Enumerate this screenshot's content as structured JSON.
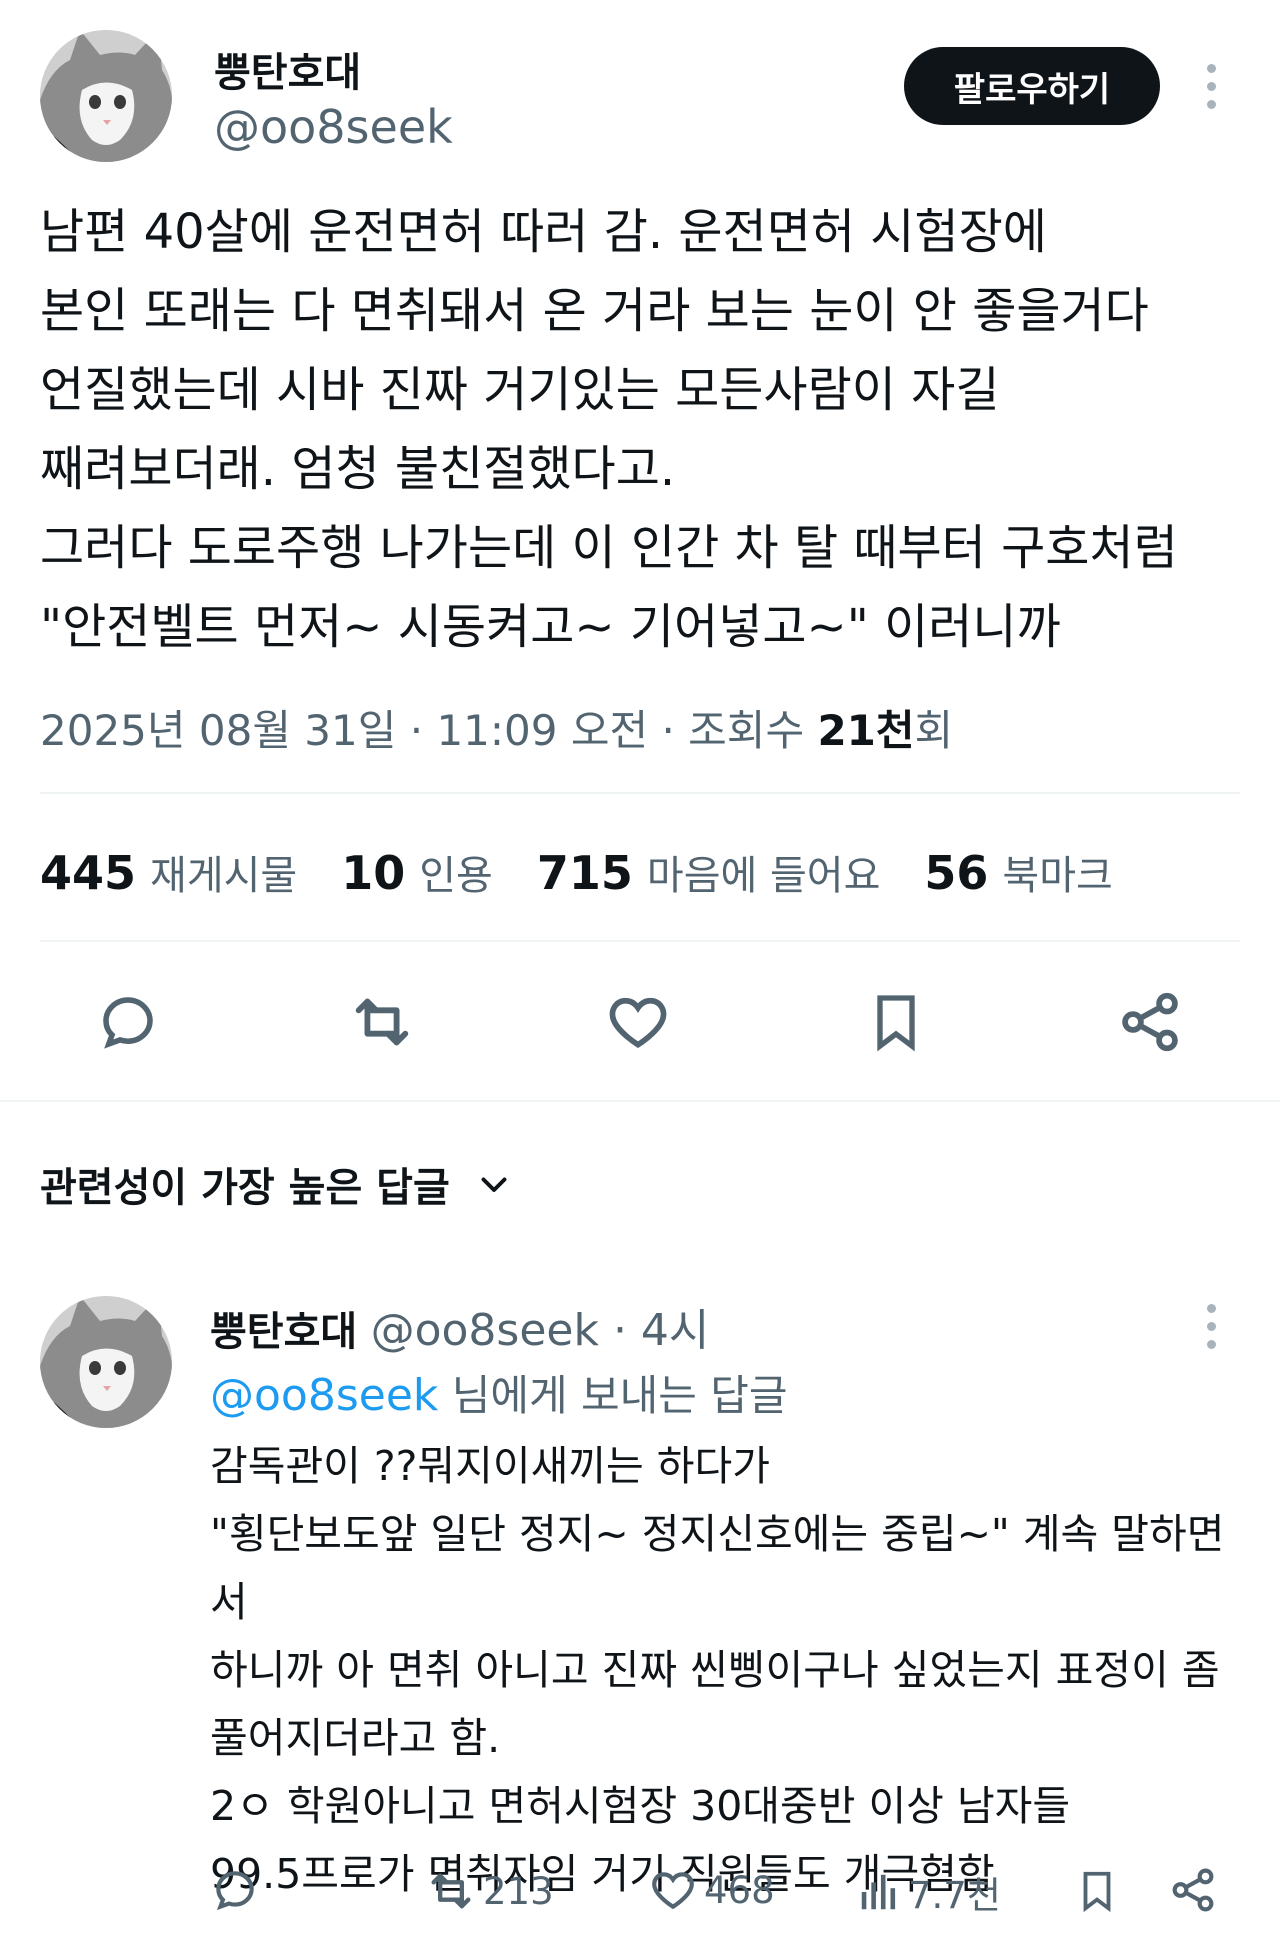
{
  "tweet": {
    "author_name": "뿡탄호대",
    "author_handle": "@oo8seek",
    "follow_label": "팔로우하기",
    "text": "남편 40살에 운전면허 따러 감. 운전면허 시험장에\n본인 또래는 다 면취돼서 온 거라 보는 눈이 안 좋을거다\n언질했는데 시바 진짜 거기있는 모든사람이 자길\n째려보더래. 엄청 불친절했다고.\n그러다 도로주행 나가는데 이 인간 차 탈 때부터 구호처럼\n\"안전벨트 먼저~ 시동켜고~  기어넣고~\" 이러니까",
    "date": "2025년 08월 31일 · 11:09 오전 · 조회수 ",
    "views": "21천",
    "views_suffix": "회"
  },
  "stats": {
    "retweets_count": "445",
    "retweets_label": "재게시물",
    "quotes_count": "10",
    "quotes_label": "인용",
    "likes_count": "715",
    "likes_label": "마음에 들어요",
    "bookmarks_count": "56",
    "bookmarks_label": "북마크"
  },
  "replies_section": {
    "sort_label": "관련성이 가장 높은 답글"
  },
  "reply": {
    "author_name": "뿡탄호대",
    "author_handle": "@oo8seek",
    "time": " · 4시",
    "replying_to_handle": "@oo8seek",
    "replying_to_suffix": " 님에게 보내는 답글",
    "text": "감독관이 ??뭐지이새끼는 하다가\n\"횡단보도앞 일단 정지~ 정지신호에는 중립~\" 계속 말하면서\n하니까 아 면취 아니고 진짜 씬삥이구나 싶었는지 표정이 좀\n풀어지더라고 함.\n2ㅇ 학원아니고 면허시험장 30대중반 이상 남자들\n99.5프로가 면취자임 거기 직원들도 개극혐함",
    "retweets": "213",
    "likes": "468",
    "views": "7.7천"
  },
  "icons": {
    "reply": "reply-icon",
    "retweet": "retweet-icon",
    "like": "heart-icon",
    "bookmark": "bookmark-icon",
    "share": "share-icon",
    "views": "views-icon",
    "more": "more-icon",
    "chevron": "chevron-down-icon"
  }
}
